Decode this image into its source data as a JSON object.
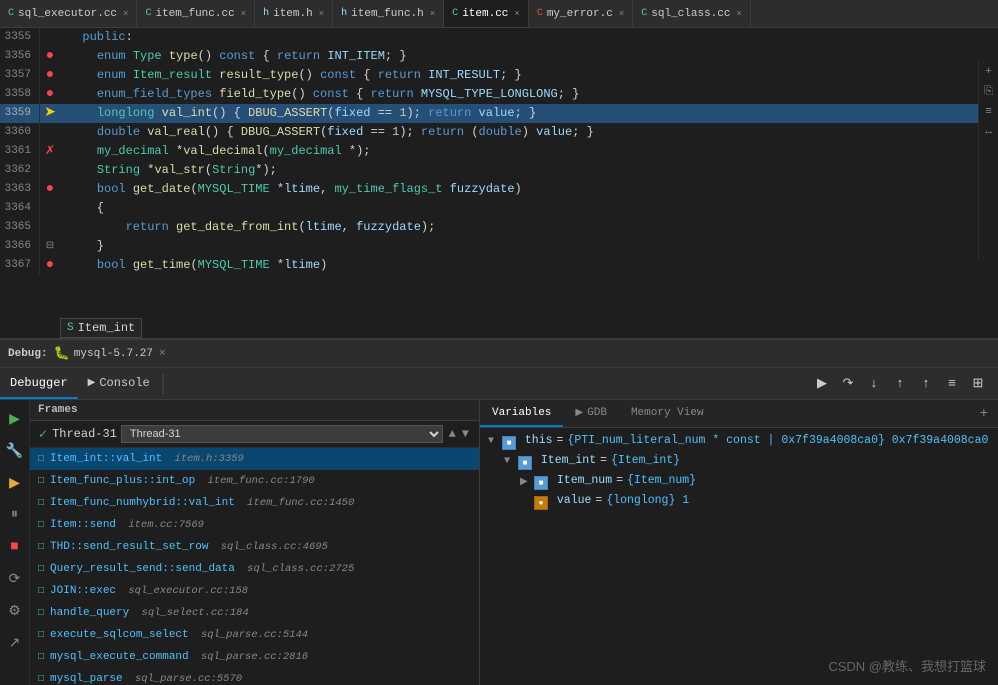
{
  "tabs": [
    {
      "name": "sql_executor.cc",
      "type": "cc",
      "active": false,
      "modified": false
    },
    {
      "name": "item_func.cc",
      "type": "cc",
      "active": false,
      "modified": false
    },
    {
      "name": "item.h",
      "type": "h",
      "active": false,
      "modified": false
    },
    {
      "name": "item_func.h",
      "type": "h",
      "active": false,
      "modified": false
    },
    {
      "name": "item.cc",
      "type": "cc",
      "active": true,
      "modified": false
    },
    {
      "name": "my_error.c",
      "type": "c",
      "active": false,
      "modified": false
    },
    {
      "name": "sql_class.cc",
      "type": "cc",
      "active": false,
      "modified": false
    }
  ],
  "code_lines": [
    {
      "num": "3355",
      "marker": "",
      "content": "  public:",
      "highlighted": false
    },
    {
      "num": "3356",
      "marker": "dot",
      "content": "    enum Type type() const { return INT_ITEM; }",
      "highlighted": false
    },
    {
      "num": "3357",
      "marker": "dot",
      "content": "    enum Item_result result_type() const { return INT_RESULT; }",
      "highlighted": false
    },
    {
      "num": "3358",
      "marker": "dot",
      "content": "    enum_field_types field_type() const { return MYSQL_TYPE_LONGLONG; }",
      "highlighted": false
    },
    {
      "num": "3359",
      "marker": "arrow",
      "content": "    longlong val_int() { DBUG_ASSERT(fixed == 1); return value; }",
      "highlighted": true
    },
    {
      "num": "3360",
      "marker": "",
      "content": "    double val_real() { DBUG_ASSERT(fixed == 1); return (double) value; }",
      "highlighted": false
    },
    {
      "num": "3361",
      "marker": "",
      "content": "    my_decimal *val_decimal(my_decimal *);",
      "highlighted": false
    },
    {
      "num": "3362",
      "marker": "",
      "content": "    String *val_str(String*);",
      "highlighted": false
    },
    {
      "num": "3363",
      "marker": "dot",
      "content": "    bool get_date(MYSQL_TIME *ltime, my_time_flags_t fuzzydate)",
      "highlighted": false
    },
    {
      "num": "3364",
      "marker": "",
      "content": "    {",
      "highlighted": false
    },
    {
      "num": "3365",
      "marker": "",
      "content": "        return get_date_from_int(ltime, fuzzydate);",
      "highlighted": false
    },
    {
      "num": "3366",
      "marker": "",
      "content": "    }",
      "highlighted": false
    },
    {
      "num": "3367",
      "marker": "dot",
      "content": "    bool get_time(MYSQL_TIME *ltime)",
      "highlighted": false
    }
  ],
  "autocomplete": "Item_int",
  "debug": {
    "label": "Debug:",
    "session": "mysql-5.7.27",
    "tabs": [
      {
        "name": "Debugger",
        "icon": "",
        "active": true
      },
      {
        "name": "Console",
        "icon": "▶",
        "active": false
      }
    ],
    "toolbar_buttons": [
      "↑",
      "↓",
      "⤓",
      "↑",
      "↑",
      "≡",
      "⊞"
    ],
    "panels": {
      "frames": {
        "header": "Frames",
        "thread": "Thread-31",
        "items": [
          {
            "name": "Item_int::val_int",
            "file": "item.h:3359",
            "selected": true
          },
          {
            "name": "Item_func_plus::int_op",
            "file": "item_func.cc:1790",
            "selected": false
          },
          {
            "name": "Item_func_numhybrid::val_int",
            "file": "item_func.cc:1450",
            "selected": false
          },
          {
            "name": "Item::send",
            "file": "item.cc:7569",
            "selected": false
          },
          {
            "name": "THD::send_result_set_row",
            "file": "sql_class.cc:4695",
            "selected": false
          },
          {
            "name": "Query_result_send::send_data",
            "file": "sql_class.cc:2725",
            "selected": false
          },
          {
            "name": "JOIN::exec",
            "file": "sql_executor.cc:158",
            "selected": false
          },
          {
            "name": "handle_query",
            "file": "sql_select.cc:184",
            "selected": false
          },
          {
            "name": "execute_sqlcom_select",
            "file": "sql_parse.cc:5144",
            "selected": false
          },
          {
            "name": "mysql_execute_command",
            "file": "sql_parse.cc:2816",
            "selected": false
          },
          {
            "name": "mysql_parse",
            "file": "sql_parse.cc:5570",
            "selected": false
          }
        ]
      },
      "variables": {
        "tabs": [
          "Variables",
          "GDB",
          "Memory View"
        ],
        "active_tab": "Variables",
        "tree": [
          {
            "indent": 0,
            "expand": "▼",
            "icon": "■",
            "icon_color": "blue",
            "name": "this",
            "equals": "=",
            "value": "{PTI_num_literal_num * const | 0x7f39a4008ca0} 0x7f39a4008ca0",
            "level": 0
          },
          {
            "indent": 1,
            "expand": "▼",
            "icon": "■",
            "icon_color": "blue",
            "name": "Item_int",
            "equals": "=",
            "value": "{Item_int}",
            "level": 1
          },
          {
            "indent": 2,
            "expand": "▶",
            "icon": "■",
            "icon_color": "blue",
            "name": "Item_num",
            "equals": "=",
            "value": "{Item_num}",
            "level": 2
          },
          {
            "indent": 2,
            "expand": "",
            "icon": "■",
            "icon_color": "orange",
            "name": "value",
            "equals": "=",
            "value": "{longlong} 1",
            "level": 2
          }
        ]
      }
    }
  },
  "watermark": "CSDN @教练、我想打篮球"
}
